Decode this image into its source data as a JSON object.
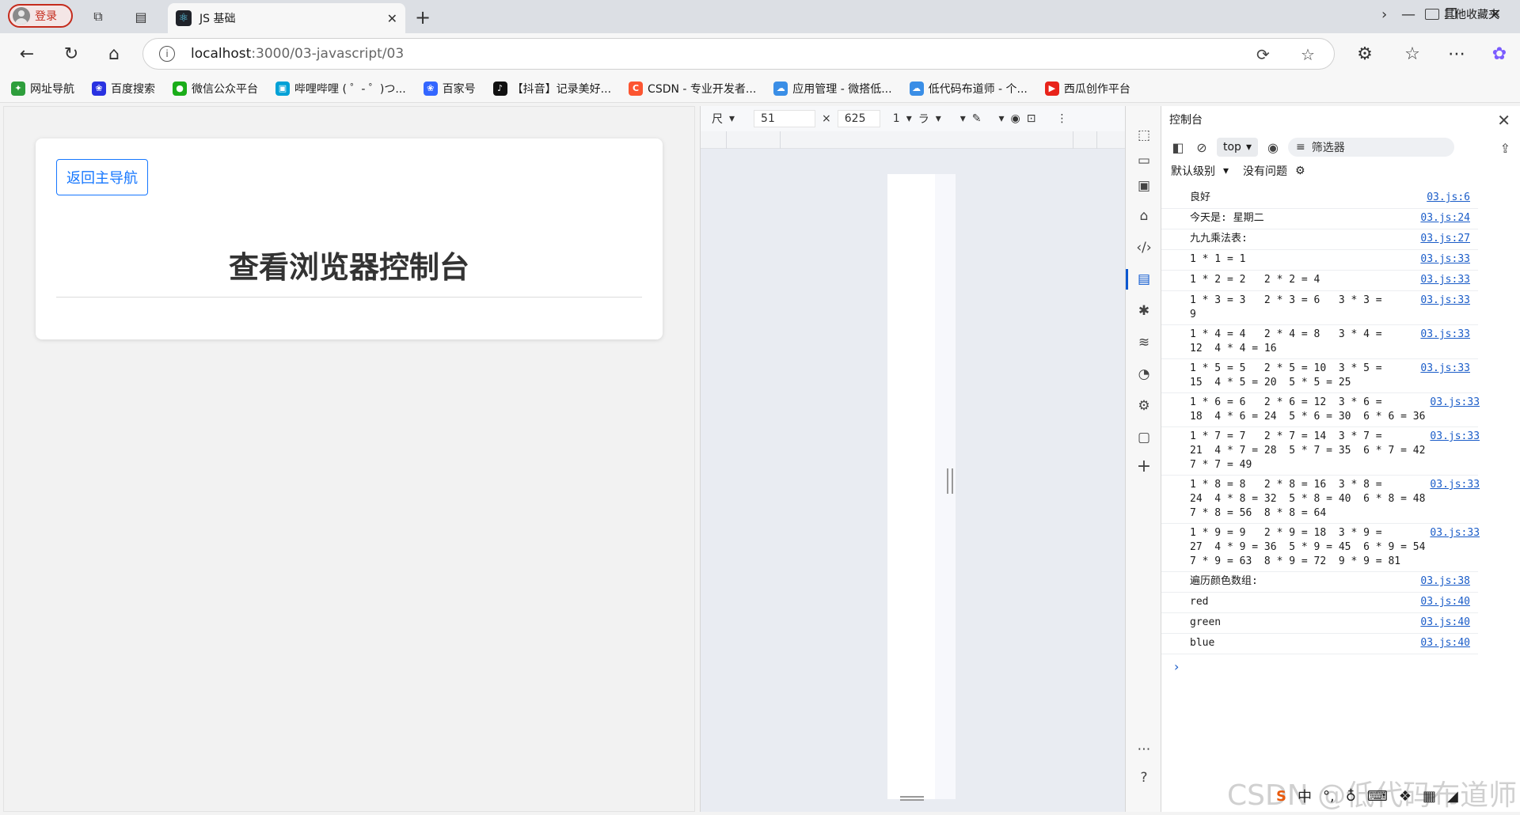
{
  "browser": {
    "login_label": "登录",
    "tab_title": "JS 基础",
    "url_host": "localhost",
    "url_path": ":3000/03-javascript/03",
    "bookmarks": [
      {
        "label": "网址导航",
        "icon": "globe-nav-icon",
        "color": "#2e9e3c",
        "glyph": "✦"
      },
      {
        "label": "百度搜索",
        "icon": "baidu-paw-icon",
        "color": "#2932e1",
        "glyph": "❀"
      },
      {
        "label": "微信公众平台",
        "icon": "wechat-icon",
        "color": "#1aad19",
        "glyph": "●"
      },
      {
        "label": "哔哩哔哩 ( ゜- ゜)つ...",
        "icon": "bilibili-tv-icon",
        "color": "#00a1d6",
        "glyph": "▣"
      },
      {
        "label": "百家号",
        "icon": "baijiahao-icon",
        "color": "#3366ff",
        "glyph": "❀"
      },
      {
        "label": "【抖音】记录美好...",
        "icon": "douyin-icon",
        "color": "#111111",
        "glyph": "♪"
      },
      {
        "label": "CSDN - 专业开发者...",
        "icon": "csdn-icon",
        "color": "#fc5531",
        "glyph": "C"
      },
      {
        "label": "应用管理 - 微搭低...",
        "icon": "cloud-icon",
        "color": "#3a8ee6",
        "glyph": "☁"
      },
      {
        "label": "低代码布道师 - 个...",
        "icon": "cloud-icon",
        "color": "#3a8ee6",
        "glyph": "☁"
      },
      {
        "label": "西瓜创作平台",
        "icon": "xigua-icon",
        "color": "#e8231a",
        "glyph": "▶"
      }
    ],
    "other_bookmarks": "其他收藏夹"
  },
  "page": {
    "back_button": "返回主导航",
    "title": "查看浏览器控制台"
  },
  "device": {
    "dimensions_label": "尺",
    "width": "51",
    "times": "×",
    "height": "625",
    "zoom": "1",
    "throttle": "ラ"
  },
  "console": {
    "title": "控制台",
    "context": "top",
    "filter_placeholder": "筛选器",
    "level": "默认级别",
    "issues": "没有问题",
    "logs": [
      {
        "text": "良好",
        "src": "03.js:6"
      },
      {
        "text": "今天是: 星期二",
        "src": "03.js:24"
      },
      {
        "text": "九九乘法表:",
        "src": "03.js:27"
      },
      {
        "text": "1 * 1 = 1",
        "src": "03.js:33"
      },
      {
        "text": "1 * 2 = 2   2 * 2 = 4",
        "src": "03.js:33"
      },
      {
        "text": "1 * 3 = 3   2 * 3 = 6   3 * 3 =\n9",
        "src": "03.js:33"
      },
      {
        "text": "1 * 4 = 4   2 * 4 = 8   3 * 4 =\n12  4 * 4 = 16",
        "src": "03.js:33"
      },
      {
        "text": "1 * 5 = 5   2 * 5 = 10  3 * 5 =\n15  4 * 5 = 20  5 * 5 = 25",
        "src": "03.js:33"
      },
      {
        "text": "1 * 6 = 6   2 * 6 = 12  3 * 6 =\n18  4 * 6 = 24  5 * 6 = 30  6 * 6 = 36",
        "src": "03.js:33"
      },
      {
        "text": "1 * 7 = 7   2 * 7 = 14  3 * 7 =\n21  4 * 7 = 28  5 * 7 = 35  6 * 7 = 42\n7 * 7 = 49",
        "src": "03.js:33"
      },
      {
        "text": "1 * 8 = 8   2 * 8 = 16  3 * 8 =\n24  4 * 8 = 32  5 * 8 = 40  6 * 8 = 48\n7 * 8 = 56  8 * 8 = 64",
        "src": "03.js:33"
      },
      {
        "text": "1 * 9 = 9   2 * 9 = 18  3 * 9 =\n27  4 * 9 = 36  5 * 9 = 45  6 * 9 = 54\n7 * 9 = 63  8 * 9 = 72  9 * 9 = 81",
        "src": "03.js:33"
      },
      {
        "text": "遍历颜色数组:",
        "src": "03.js:38"
      },
      {
        "text": "red",
        "src": "03.js:40"
      },
      {
        "text": "green",
        "src": "03.js:40"
      },
      {
        "text": "blue",
        "src": "03.js:40"
      }
    ]
  },
  "watermark": "CSDN @低代码布道师",
  "tray": {
    "ime": "中"
  },
  "colors": {
    "accent": "#1677ff",
    "link": "#1a5cc8",
    "login_red": "#c42b1c"
  }
}
